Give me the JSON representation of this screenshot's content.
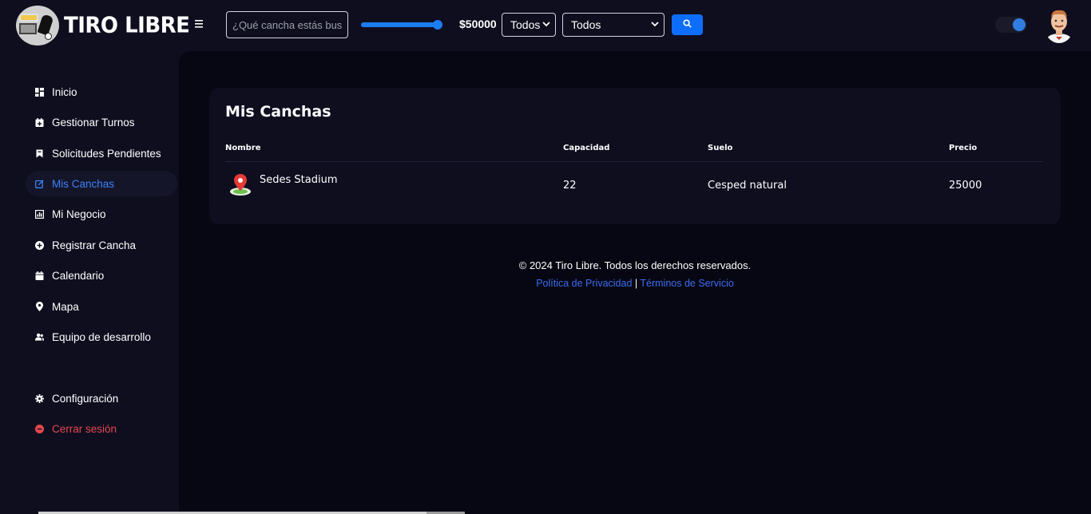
{
  "brand": {
    "name": "TIRO LIBRE"
  },
  "header": {
    "menu_icon": "hamburger-icon",
    "search_placeholder": "¿Qué cancha estás bus",
    "price_slider_fraction": 1.0,
    "price_label": "$50000",
    "select_1_value": "Todos",
    "select_2_value": "Todos",
    "search_button_icon": "search-icon",
    "theme_toggle_on": true,
    "accent": "#0d6efd"
  },
  "sidebar": {
    "items": [
      {
        "label": "Inicio",
        "icon": "dashboard-icon"
      },
      {
        "label": "Gestionar Turnos",
        "icon": "calendar-plus-icon"
      },
      {
        "label": "Solicitudes Pendientes",
        "icon": "bookmark-icon"
      },
      {
        "label": "Mis Canchas",
        "icon": "edit-icon",
        "active": true
      },
      {
        "label": "Mi Negocio",
        "icon": "chart-icon"
      },
      {
        "label": "Registrar Cancha",
        "icon": "plus-circle-icon"
      },
      {
        "label": "Calendario",
        "icon": "calendar-icon"
      },
      {
        "label": "Mapa",
        "icon": "map-pin-icon"
      },
      {
        "label": "Equipo de desarrollo",
        "icon": "users-icon"
      }
    ],
    "settings_label": "Configuración",
    "logout_label": "Cerrar sesión",
    "active_color": "#3b82f6",
    "danger_color": "#e5484d"
  },
  "main": {
    "title": "Mis Canchas",
    "columns": [
      "Nombre",
      "Capacidad",
      "Suelo",
      "Precio"
    ],
    "rows": [
      {
        "name": "Sedes Stadium",
        "capacity": "22",
        "surface": "Cesped natural",
        "price": "25000"
      }
    ]
  },
  "footer": {
    "copyright": "© 2024 Tiro Libre. Todos los derechos reservados.",
    "privacy": "Política de Privacidad",
    "separator": "|",
    "terms": "Términos de Servicio"
  }
}
